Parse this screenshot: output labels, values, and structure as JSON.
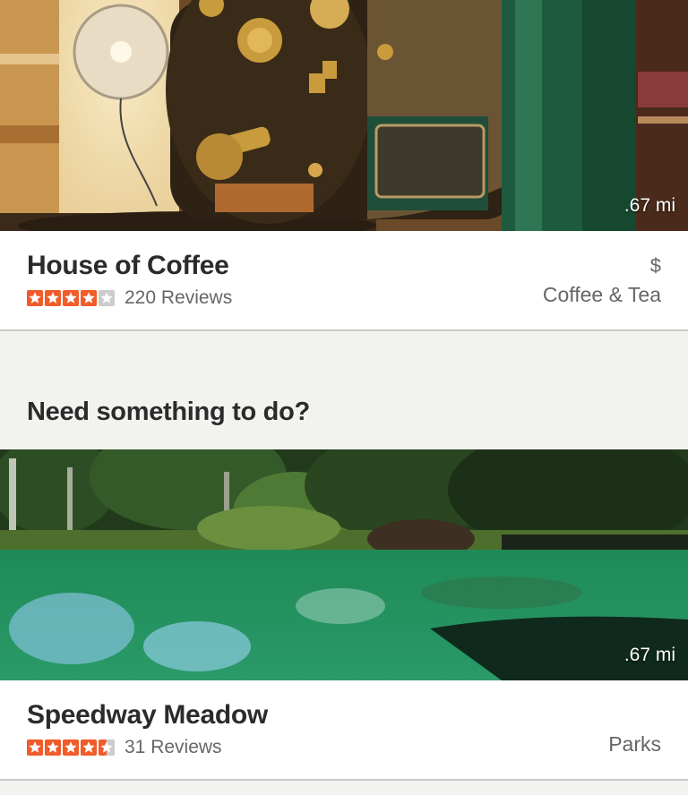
{
  "businesses": [
    {
      "name": "House of Coffee",
      "distance": ".67 mi",
      "reviews": "220 Reviews",
      "price": "$",
      "category": "Coffee & Tea",
      "rating": 4,
      "photo_icon": "coffee-roaster-photo"
    },
    {
      "name": "Speedway Meadow",
      "distance": ".67 mi",
      "reviews": "31 Reviews",
      "price": "",
      "category": "Parks",
      "rating": 4.5,
      "photo_icon": "pond-photo"
    }
  ],
  "section": {
    "title": "Need something to do?"
  },
  "colors": {
    "star_fill": "#f15c2b",
    "star_empty": "#cccccc"
  }
}
